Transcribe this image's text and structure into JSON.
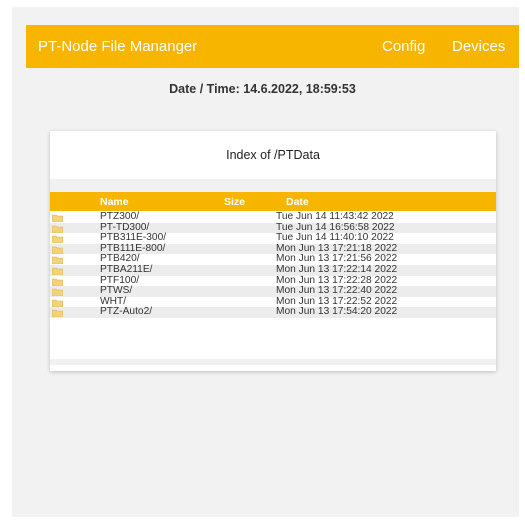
{
  "header": {
    "title": "PT-Node File Mananger",
    "nav": {
      "config": "Config",
      "devices": "Devices"
    }
  },
  "status": {
    "datetime": "Date / Time: 14.6.2022, 18:59:53"
  },
  "index": {
    "title": "Index of /PTData",
    "columns": {
      "name": "Name",
      "size": "Size",
      "date": "Date"
    },
    "rows": [
      {
        "icon": "folder-icon",
        "name": "PTZ300/",
        "size": "",
        "date": "Tue Jun 14 11:43:42 2022"
      },
      {
        "icon": "folder-icon",
        "name": "PT-TD300/",
        "size": "",
        "date": "Tue Jun 14 16:56:58 2022"
      },
      {
        "icon": "folder-icon",
        "name": "PTB311E-300/",
        "size": "",
        "date": "Tue Jun 14 11:40:10 2022"
      },
      {
        "icon": "folder-icon",
        "name": "PTB111E-800/",
        "size": "",
        "date": "Mon Jun 13 17:21:18 2022"
      },
      {
        "icon": "folder-icon",
        "name": "PTB420/",
        "size": "",
        "date": "Mon Jun 13 17:21:56 2022"
      },
      {
        "icon": "folder-icon",
        "name": "PTBA211E/",
        "size": "",
        "date": "Mon Jun 13 17:22:14 2022"
      },
      {
        "icon": "folder-icon",
        "name": "PTF100/",
        "size": "",
        "date": "Mon Jun 13 17:22:28 2022"
      },
      {
        "icon": "folder-icon",
        "name": "PTWS/",
        "size": "",
        "date": "Mon Jun 13 17:22:40 2022"
      },
      {
        "icon": "folder-icon",
        "name": "WHT/",
        "size": "",
        "date": "Mon Jun 13 17:22:52 2022"
      },
      {
        "icon": "folder-icon",
        "name": "PTZ-Auto2/",
        "size": "",
        "date": "Mon Jun 13 17:54:20 2022"
      }
    ]
  },
  "colors": {
    "accent": "#f8b500",
    "folder": "#f2d27a",
    "page_background": "#f2f2f2"
  }
}
